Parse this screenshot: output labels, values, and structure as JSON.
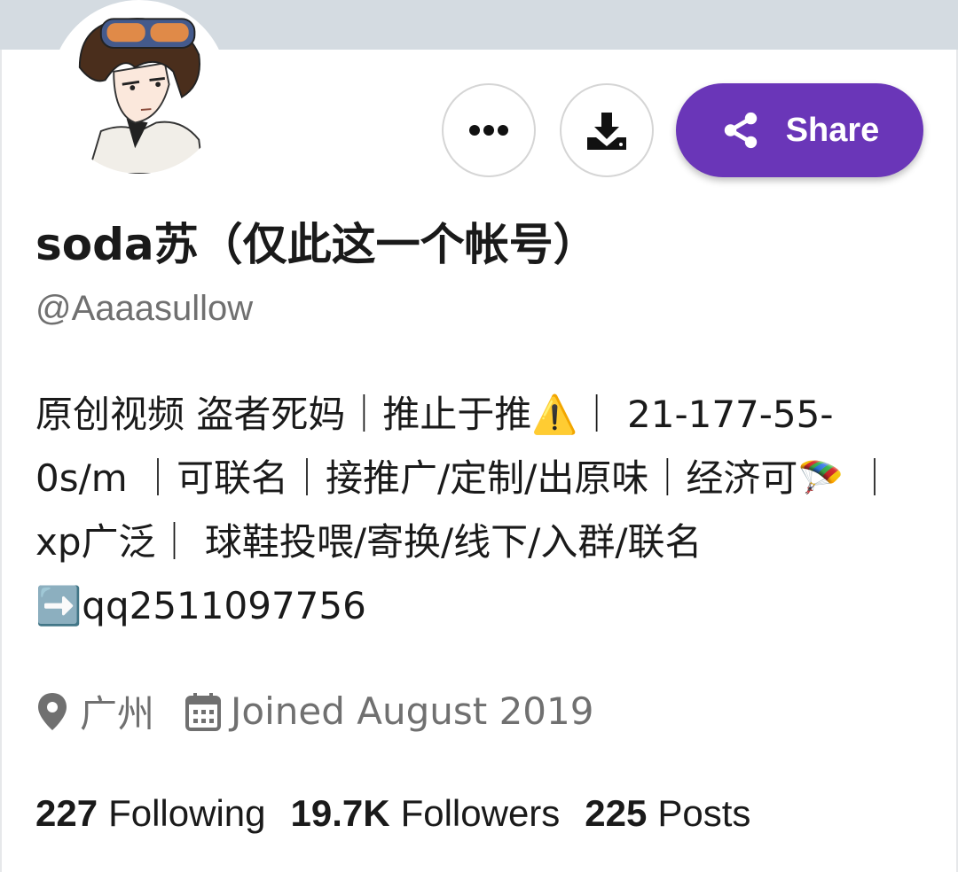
{
  "profile": {
    "display_name": "soda苏（仅此这一个帐号）",
    "handle": "@Aaaasullow",
    "bio": "原创视频 盗者死妈｜推止于推⚠️｜ 21-177-55-0s/m ｜可联名｜接推广/定制/出原味｜经济可🪂 ｜ xp广泛｜ 球鞋投喂/寄换/线下/入群/联名➡️qq2511097756",
    "location": "广州",
    "joined": "Joined August 2019"
  },
  "actions": {
    "more_icon": "more-horizontal-icon",
    "download_icon": "download-icon",
    "share_label": "Share",
    "share_icon": "share-icon"
  },
  "stats": {
    "following_count": "227",
    "following_label": "Following",
    "followers_count": "19.7K",
    "followers_label": "Followers",
    "posts_count": "225",
    "posts_label": "Posts"
  },
  "colors": {
    "accent": "#6a36b8",
    "banner": "#d4dbe1",
    "muted_text": "#707070"
  }
}
